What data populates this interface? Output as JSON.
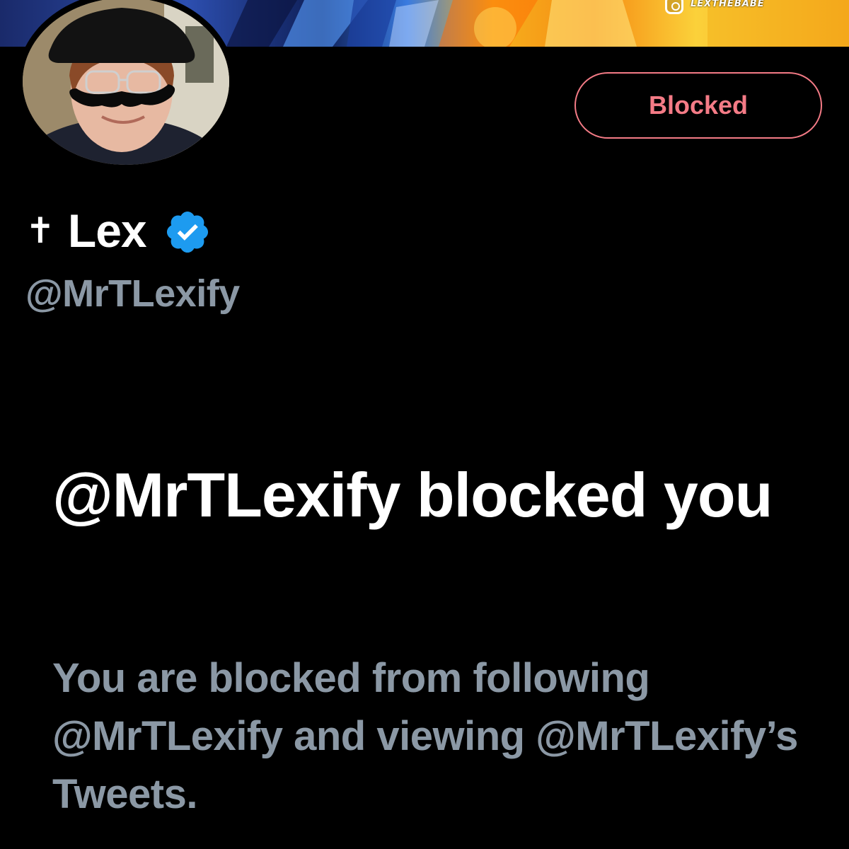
{
  "banner": {
    "watermark_handle": "LEXTHEBABE"
  },
  "profile": {
    "name_prefix_symbol": "✝",
    "display_name": "Lex",
    "handle": "@MrTLexify",
    "verified_color": "#1d9bf0",
    "verified": true
  },
  "actions": {
    "blocked_label": "Blocked",
    "blocked_color": "#f47b86"
  },
  "block_notice": {
    "title": "@MrTLexify blocked you",
    "message": "You are blocked from following @MrTLexify and viewing @MrTLexify’s Tweets."
  }
}
